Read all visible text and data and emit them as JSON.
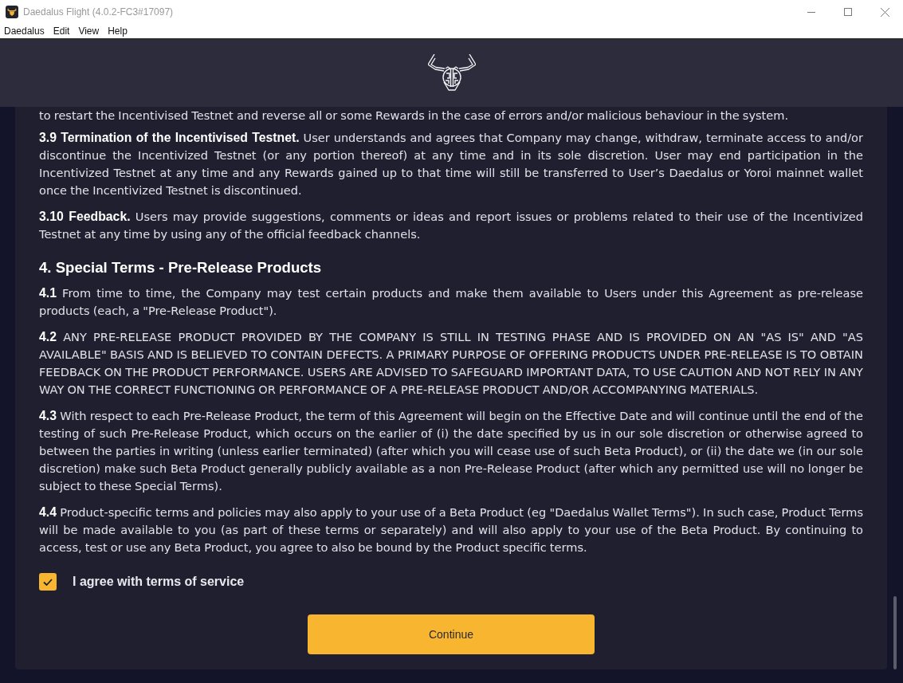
{
  "window": {
    "title": "Daedalus Flight (4.0.2-FC3#17097)"
  },
  "menu_bar": [
    "Daedalus",
    "Edit",
    "View",
    "Help"
  ],
  "terms": [
    {
      "kind": "paragraph",
      "text": "to restart the Incentivised Testnet and reverse all or some Rewards in the case of errors and/or malicious behaviour in the system."
    },
    {
      "kind": "paragraph",
      "text": "**3.9 Termination of the Incentivised Testnet.** User understands and agrees that Company may change, withdraw, terminate access to and/or discontinue the Incentivized Testnet (or any portion thereof) at any time and in its sole discretion. User may end participation in the Incentivized Testnet at any time and any Rewards gained up to that time will still be transferred to User’s Daedalus or Yoroi mainnet wallet once the Incentivized Testnet is discontinued."
    },
    {
      "kind": "paragraph",
      "text": "**3.10 Feedback.** Users may provide suggestions, comments or ideas and report issues or problems related to their use of the Incentivized Testnet at any time by using any of the official feedback channels."
    },
    {
      "kind": "heading",
      "text": "4. Special Terms - Pre-Release Products"
    },
    {
      "kind": "paragraph",
      "text": "**4.1** From time to time, the Company may test certain products and make them available to Users under this Agreement as pre-release products (each, a \"Pre-Release Product\")."
    },
    {
      "kind": "paragraph",
      "text": "**4.2** ANY PRE-RELEASE PRODUCT PROVIDED BY THE COMPANY IS STILL IN TESTING PHASE AND IS PROVIDED ON AN \"AS IS\" AND \"AS AVAILABLE\" BASIS AND IS BELIEVED TO CONTAIN DEFECTS. A PRIMARY PURPOSE OF OFFERING PRODUCTS UNDER PRE-RELEASE IS TO OBTAIN FEEDBACK ON THE PRODUCT PERFORMANCE. USERS ARE ADVISED TO SAFEGUARD IMPORTANT DATA, TO USE CAUTION AND NOT RELY IN ANY WAY ON THE CORRECT FUNCTIONING OR PERFORMANCE OF A PRE-RELEASE PRODUCT AND/OR ACCOMPANYING MATERIALS."
    },
    {
      "kind": "paragraph",
      "text": "**4.3** With respect to each Pre-Release Product, the term of this Agreement will begin on the Effective Date and will continue until the end of the testing of such Pre-Release Product, which occurs on the earlier of (i) the date specified by us in our sole discretion or otherwise agreed to between the parties in writing (unless earlier terminated) (after which you will cease use of such Beta Product), or (ii) the date we (in our sole discretion) make such Beta Product generally publicly available as a non Pre-Release Product (after which any permitted use will no longer be subject to these Special Terms)."
    },
    {
      "kind": "paragraph",
      "text": "**4.4** Product-specific terms and policies may also apply to your use of a Beta Product (eg \"Daedalus Wallet Terms\"). In such case, Product Terms will be made available to you (as part of these terms or separately) and will also apply to your use of the Beta Product. By continuing to access, test or use any Beta Product, you agree to also be bound by the Product specific terms."
    }
  ],
  "agreement": {
    "label": "I agree with terms of service",
    "checked": true
  },
  "continue_button": {
    "label": "Continue"
  }
}
